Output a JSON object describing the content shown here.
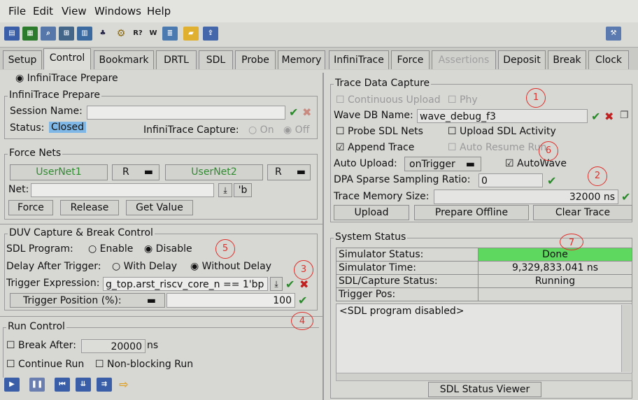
{
  "menubar": {
    "items": [
      "File",
      "Edit",
      "View",
      "Windows",
      "Help"
    ]
  },
  "toolbar": {
    "icons": [
      "probe-icon",
      "memory-icon",
      "search-icon",
      "network-icon",
      "chart-icon",
      "tree-icon",
      "gear-icon",
      "r-query-icon",
      "w-icon",
      "abc-icon",
      "open-folder-icon",
      "export-icon",
      "settings-icon"
    ],
    "r_label": "R?",
    "w_label": "W"
  },
  "tabs": [
    {
      "label": "Setup"
    },
    {
      "label": "Control"
    },
    {
      "label": "Bookmark"
    },
    {
      "label": "DRTL"
    },
    {
      "label": "SDL"
    },
    {
      "label": "Probe"
    },
    {
      "label": "Memory"
    },
    {
      "label": "InfiniTrace"
    },
    {
      "label": "Force"
    },
    {
      "label": "Assertions"
    },
    {
      "label": "Deposit"
    },
    {
      "label": "Break"
    },
    {
      "label": "Clock"
    }
  ],
  "left": {
    "radio_label": "InfiniTrace Prepare",
    "infinitrace": {
      "title": "InfiniTrace Prepare",
      "session_label": "Session Name:",
      "session_value": "",
      "status_label": "Status:",
      "status_value": "Closed",
      "capture_label": "InfiniTrace Capture:",
      "capture_on": "On",
      "capture_off": "Off"
    },
    "force_nets": {
      "title": "Force Nets",
      "net1": "UserNet1",
      "net1_mode": "R",
      "net2": "UserNet2",
      "net2_mode": "R",
      "net_label": "Net:",
      "net_value": "",
      "radix_btn": "'b",
      "force_btn": "Force",
      "release_btn": "Release",
      "get_value_btn": "Get Value"
    },
    "duv": {
      "title": "DUV Capture & Break Control",
      "sdl_program_label": "SDL Program:",
      "sdl_enable": "Enable",
      "sdl_disable": "Disable",
      "delay_label": "Delay After Trigger:",
      "with_delay": "With Delay",
      "without_delay": "Without Delay",
      "trigger_expr_label": "Trigger Expression:",
      "trigger_expr_value": "g_top.arst_riscv_core_n == 1'bp",
      "trigger_pos_label": "Trigger Position (%):",
      "trigger_pos_value": "100"
    },
    "run_control": {
      "title": "Run Control",
      "break_after_label": "Break After:",
      "break_after_value": "20000",
      "break_after_unit": "ns",
      "continue_run": "Continue Run",
      "non_blocking": "Non-blocking Run"
    }
  },
  "right": {
    "trace": {
      "title": "Trace Data Capture",
      "continuous_upload": "Continuous Upload",
      "phy": "Phy",
      "wave_db_label": "Wave DB Name:",
      "wave_db_value": "wave_debug_f3",
      "probe_sdl_nets": "Probe SDL Nets",
      "upload_sdl_activity": "Upload SDL Activity",
      "append_trace": "Append Trace",
      "auto_resume_run": "Auto Resume Run",
      "auto_upload_label": "Auto Upload:",
      "auto_upload_value": "onTrigger",
      "autowave": "AutoWave",
      "dpa_label": "DPA Sparse Sampling Ratio:",
      "dpa_value": "0",
      "trace_mem_label": "Trace Memory Size:",
      "trace_mem_value": "32000 ns",
      "upload_btn": "Upload",
      "prepare_offline_btn": "Prepare Offline",
      "clear_trace_btn": "Clear Trace"
    },
    "system_status": {
      "title": "System Status",
      "rows": [
        {
          "label": "Simulator Status:",
          "value": "Done"
        },
        {
          "label": "Simulator Time:",
          "value": "9,329,833.041 ns"
        },
        {
          "label": "SDL/Capture Status:",
          "value": "Running"
        },
        {
          "label": "Trigger Pos:",
          "value": ""
        }
      ],
      "log_text": "<SDL program disabled>",
      "viewer_btn": "SDL Status Viewer"
    }
  },
  "annotations": [
    "1",
    "2",
    "3",
    "4",
    "5",
    "6",
    "7"
  ],
  "colors": {
    "done_green": "#5fd85f",
    "status_closed_bg": "#7fb8e6",
    "annotation_red": "#e0302a",
    "check_green": "#2a8a2a"
  }
}
